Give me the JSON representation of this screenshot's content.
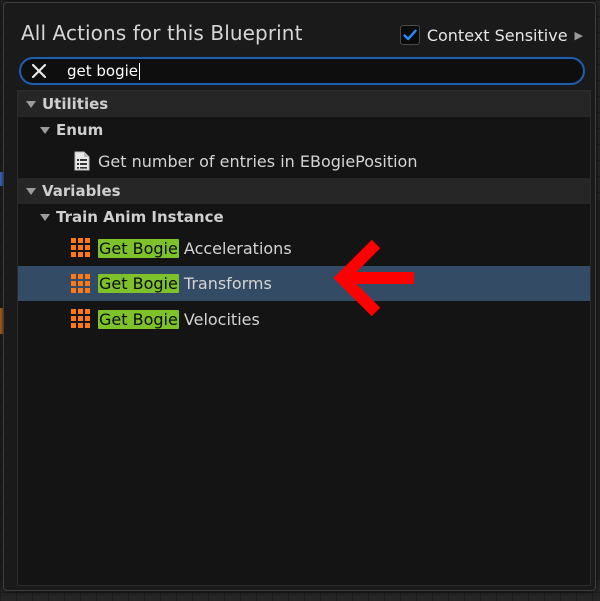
{
  "header": {
    "title": "All Actions for this Blueprint",
    "context_sensitive": {
      "label": "Context Sensitive",
      "checked": true
    }
  },
  "search": {
    "value": "get bogie",
    "placeholder": ""
  },
  "tree": {
    "utilities": {
      "label": "Utilities"
    },
    "enum": {
      "label": "Enum"
    },
    "enum_item": {
      "label": "Get number of entries in EBogiePosition"
    },
    "variables": {
      "label": "Variables"
    },
    "train_anim": {
      "label": "Train Anim Instance"
    },
    "items": [
      {
        "match": "Get Bogie",
        "rest": " Accelerations",
        "selected": false
      },
      {
        "match": "Get Bogie",
        "rest": " Transforms",
        "selected": true
      },
      {
        "match": "Get Bogie",
        "rest": " Velocities",
        "selected": false
      }
    ]
  },
  "colors": {
    "accent": "#1d5fb0",
    "highlight": "#7dc22a",
    "variable_icon": "#ff7a12",
    "selection": "#344b66",
    "annotation_arrow": "#ff0000"
  },
  "icons": {
    "check": "checkmark-icon",
    "clear": "close-icon",
    "expand": "expand-arrow-icon",
    "variable": "variable-grid-icon",
    "function": "document-list-icon",
    "annotation": "red-arrow-icon"
  }
}
